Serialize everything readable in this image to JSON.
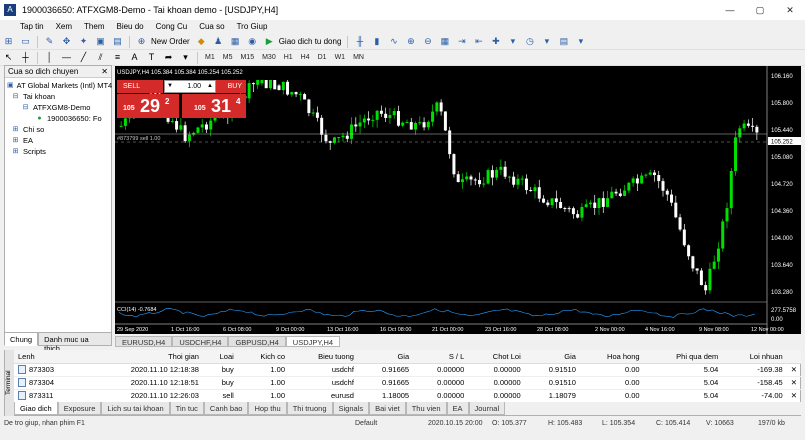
{
  "window": {
    "title": "1900036650: ATFXGM8-Demo - Tai khoan demo - [USDJPY,H4]",
    "buttons": [
      "—",
      "▢",
      "✕"
    ]
  },
  "menu": [
    "Tap tin",
    "Xem",
    "Them",
    "Bieu do",
    "Cong Cu",
    "Cua so",
    "Tro Giup"
  ],
  "toolbar1": {
    "new_order": "New Order",
    "auto_trade": "Giao dich tu dong"
  },
  "timeframes": [
    "M1",
    "M5",
    "M15",
    "M30",
    "H1",
    "H4",
    "D1",
    "W1",
    "MN"
  ],
  "navigator": {
    "title": "Cua so dich chuyen",
    "items": [
      "AT Global Markets (Intl) MT4",
      "Tai khoan",
      "ATFXGM8-Demo",
      "1900036650: Fo",
      "Chi so",
      "EA",
      "Scripts"
    ],
    "tabs": [
      "Chung",
      "Danh muc ua thich"
    ]
  },
  "chart": {
    "symbol_header": "USDJPY,H4  105.384 105.384 105.254 105.252",
    "sell_label": "SELL",
    "buy_label": "BUY",
    "lot": "1.00",
    "sell_price": {
      "prefix": "105",
      "big": "29",
      "sup": "2"
    },
    "buy_price": {
      "prefix": "105",
      "big": "31",
      "sup": "4"
    },
    "order_line_label": "#873799 sell 1.00",
    "indicator_label": "CCI(14) -0.7684",
    "price_line": "105.252",
    "y_labels": [
      "106.160",
      "105.800",
      "105.440",
      "105.080",
      "104.720",
      "104.360",
      "104.000",
      "103.640",
      "103.280"
    ],
    "x_labels": [
      "29 Sep 2020",
      "1 Oct 16:00",
      "6 Oct 08:00",
      "9 Oct 00:00",
      "13 Oct 16:00",
      "16 Oct 08:00",
      "21 Oct 00:00",
      "23 Oct 16:00",
      "28 Oct 08:00",
      "2 Nov 00:00",
      "4 Nov 16:00",
      "9 Nov 08:00",
      "12 Nov 00:00"
    ],
    "ind_labels": [
      "277.5758",
      "0.00"
    ]
  },
  "chart_tabs": [
    "EURUSD,H4",
    "USDCHF,H4",
    "GBPUSD,H4",
    "USDJPY,H4"
  ],
  "terminal": {
    "side_label": "Terminal",
    "columns": [
      "Lenh",
      "Thoi gian",
      "Loai",
      "Kich co",
      "Bieu tuong",
      "Gia",
      "S / L",
      "Chot Loi",
      "Gia",
      "Hoa hong",
      "Phi qua dem",
      "Loi nhuan"
    ],
    "rows": [
      [
        "873303",
        "2020.11.10 12:18:38",
        "buy",
        "1.00",
        "usdchf",
        "0.91665",
        "0.00000",
        "0.00000",
        "0.91510",
        "0.00",
        "5.04",
        "-169.38"
      ],
      [
        "873304",
        "2020.11.10 12:18:51",
        "buy",
        "1.00",
        "usdchf",
        "0.91665",
        "0.00000",
        "0.00000",
        "0.91510",
        "0.00",
        "5.04",
        "-158.45"
      ],
      [
        "873311",
        "2020.11.10 12:26:03",
        "sell",
        "1.00",
        "eurusd",
        "1.18005",
        "0.00000",
        "0.00000",
        "1.18079",
        "0.00",
        "5.04",
        "-74.00"
      ]
    ],
    "tabs": [
      "Giao dich",
      "Exposure",
      "Lich su tai khoan",
      "Tin tuc",
      "Canh bao",
      "Hop thu",
      "Thi truong",
      "Signals",
      "Bai viet",
      "Thu vien",
      "EA",
      "Journal"
    ]
  },
  "status": {
    "help": "De tro giup, nhan phim F1",
    "profile": "Default",
    "time": "2020.10.15 20:00",
    "open": "O: 105.377",
    "high": "H: 105.483",
    "low": "L: 105.354",
    "close": "C: 105.414",
    "volume": "V: 10663",
    "memory": "197/0 kb"
  },
  "colors": {
    "candle_up": "#00e000",
    "candle_down": "#ffffff",
    "chart_bg": "#000000",
    "trade_red": "#d42a2a"
  }
}
